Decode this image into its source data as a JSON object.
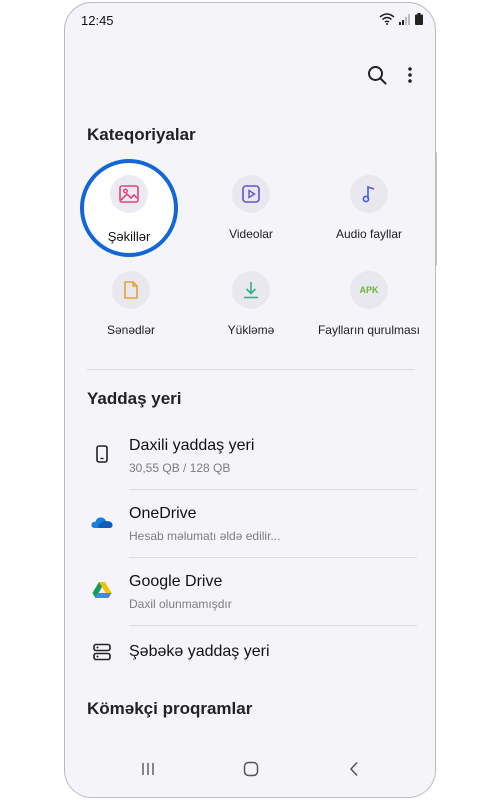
{
  "status": {
    "time": "12:45"
  },
  "categories": {
    "title": "Kateqoriyalar",
    "items": [
      {
        "label": "Şəkillər",
        "icon": "image-icon"
      },
      {
        "label": "Videolar",
        "icon": "video-icon"
      },
      {
        "label": "Audio fayllar",
        "icon": "music-icon"
      },
      {
        "label": "Sənədlər",
        "icon": "document-icon"
      },
      {
        "label": "Yükləmə",
        "icon": "download-icon"
      },
      {
        "label": "Faylların qurulması",
        "icon": "apk-icon",
        "badge": "APK"
      }
    ]
  },
  "storage": {
    "title": "Yaddaş yeri",
    "items": [
      {
        "title": "Daxili yaddaş yeri",
        "sub": "30,55 QB / 128 QB",
        "icon": "phone-icon"
      },
      {
        "title": "OneDrive",
        "sub": "Hesab məlumatı əldə edilir...",
        "icon": "onedrive-icon"
      },
      {
        "title": "Google Drive",
        "sub": "Daxil olunmamışdır",
        "icon": "google-drive-icon"
      },
      {
        "title": "Şəbəkə yaddaş yeri",
        "icon": "network-storage-icon"
      }
    ]
  },
  "helpers": {
    "title": "Köməkçi proqramlar"
  },
  "colors": {
    "accent": "#1466d8",
    "background": "#f5f4f9"
  }
}
